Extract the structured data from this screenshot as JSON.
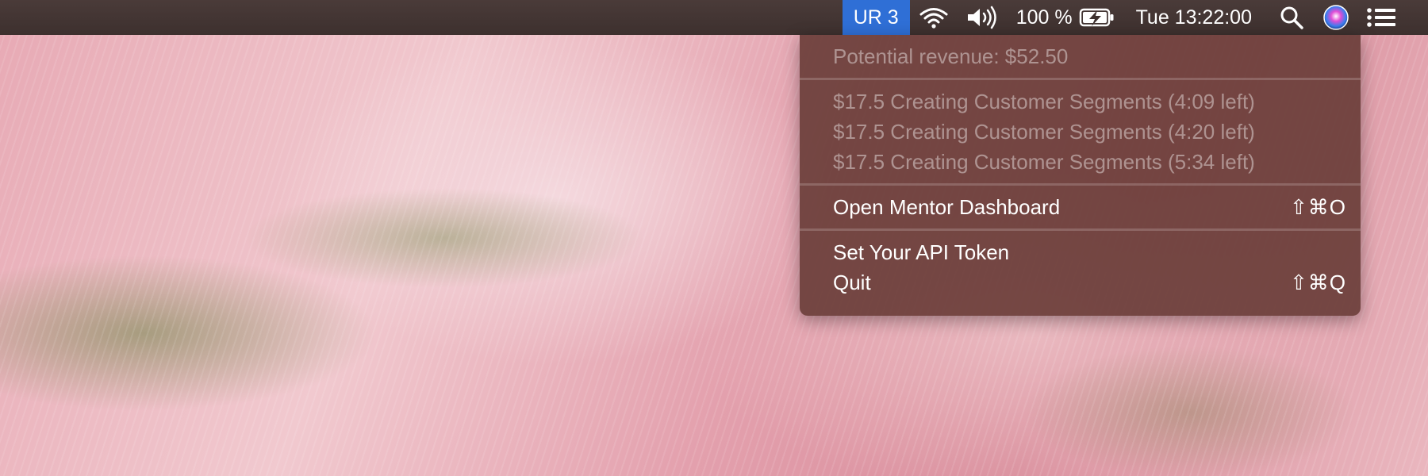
{
  "menubar": {
    "app_status": "UR 3",
    "wifi_icon": "wifi-icon",
    "volume_icon": "volume-icon",
    "battery_percent": "100 %",
    "battery_icon": "battery-charging-icon",
    "clock": "Tue 13:22:00",
    "search_icon": "spotlight-search-icon",
    "siri_icon": "siri-icon",
    "notification_icon": "notification-center-icon"
  },
  "dropdown": {
    "revenue": "Potential revenue: $52.50",
    "reviews": [
      "$17.5 Creating Customer Segments (4:09 left)",
      "$17.5 Creating Customer Segments (4:20 left)",
      "$17.5 Creating Customer Segments (5:34 left)"
    ],
    "open_dashboard": {
      "label": "Open Mentor Dashboard",
      "shortcut": "⇧⌘O"
    },
    "set_token": {
      "label": "Set Your API Token"
    },
    "quit": {
      "label": "Quit",
      "shortcut": "⇧⌘Q"
    }
  },
  "colors": {
    "menubar": "#3d302e",
    "active_item": "#2f6fd6",
    "dropdown_bg": "#6c3e3a"
  }
}
